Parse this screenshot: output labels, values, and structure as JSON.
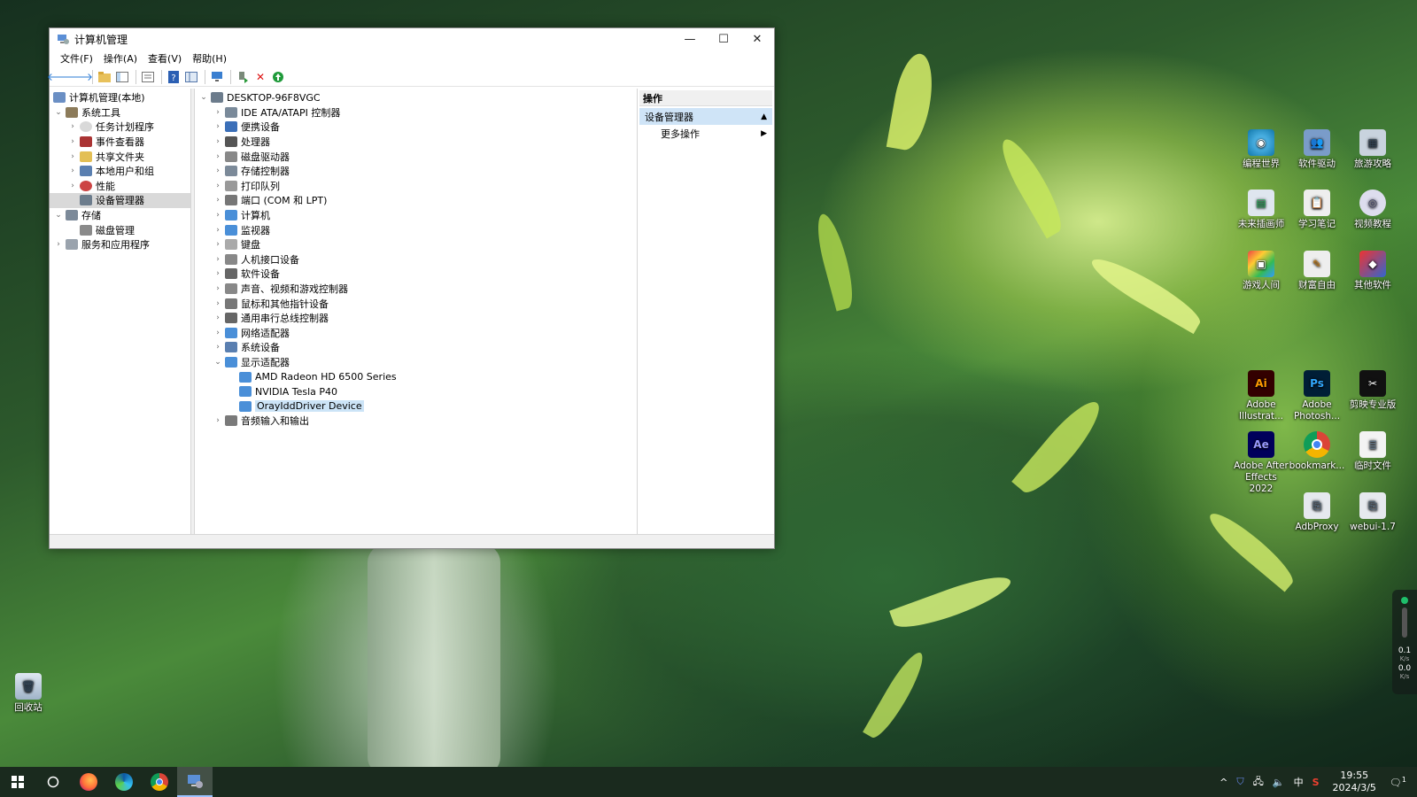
{
  "window": {
    "title": "计算机管理",
    "controls": {
      "minimize": "—",
      "maximize": "☐",
      "close": "✕"
    }
  },
  "menubar": {
    "items": [
      "文件(F)",
      "操作(A)",
      "查看(V)",
      "帮助(H)"
    ]
  },
  "toolbar": {
    "icons": [
      "back-icon",
      "forward-icon",
      "up-folder-icon",
      "show-hide-tree-icon",
      "properties-icon",
      "help-icon",
      "view-icon",
      "monitor-icon",
      "update-driver-icon",
      "uninstall-icon",
      "enable-icon"
    ]
  },
  "left_tree": {
    "root": "计算机管理(本地)",
    "system_tools": "系统工具",
    "task_scheduler": "任务计划程序",
    "event_viewer": "事件查看器",
    "shared_folders": "共享文件夹",
    "local_users": "本地用户和组",
    "performance": "性能",
    "device_manager": "设备管理器",
    "storage": "存储",
    "disk_management": "磁盘管理",
    "services": "服务和应用程序"
  },
  "device_tree": {
    "root": "DESKTOP-96F8VGC",
    "categories": [
      "IDE ATA/ATAPI 控制器",
      "便携设备",
      "处理器",
      "磁盘驱动器",
      "存储控制器",
      "打印队列",
      "端口 (COM 和 LPT)",
      "计算机",
      "监视器",
      "键盘",
      "人机接口设备",
      "软件设备",
      "声音、视频和游戏控制器",
      "鼠标和其他指针设备",
      "通用串行总线控制器",
      "网络适配器",
      "系统设备",
      "显示适配器"
    ],
    "display_adapters": [
      "AMD Radeon HD 6500 Series",
      "NVIDIA Tesla P40",
      "OrayIddDriver Device"
    ],
    "last_category": "音频输入和输出"
  },
  "actions": {
    "header": "操作",
    "section": "设备管理器",
    "more": "更多操作"
  },
  "desktop_icons": {
    "biancheng": "编程世界",
    "ruanjian": "软件驱动",
    "lvyou": "旅游攻略",
    "weilai": "未来插画师",
    "xuexi": "学习笔记",
    "shipin": "视频教程",
    "youxi": "游戏人间",
    "caifu": "财富自由",
    "qita": "其他软件",
    "ai": "Adobe Illustrat...",
    "ps": "Adobe Photosh...",
    "jianying": "剪映专业版",
    "ae": "Adobe After Effects 2022",
    "bookmark": "bookmark...",
    "linshi": "临时文件",
    "adbproxy": "AdbProxy",
    "webui": "webui-1.7",
    "recycle": "回收站"
  },
  "widget": {
    "up": "0.1",
    "up_unit": "K/s",
    "down": "0.0",
    "down_unit": "K/s"
  },
  "taskbar": {
    "time": "19:55",
    "date": "2024/3/5",
    "ime": "中",
    "notification_count": "1"
  }
}
